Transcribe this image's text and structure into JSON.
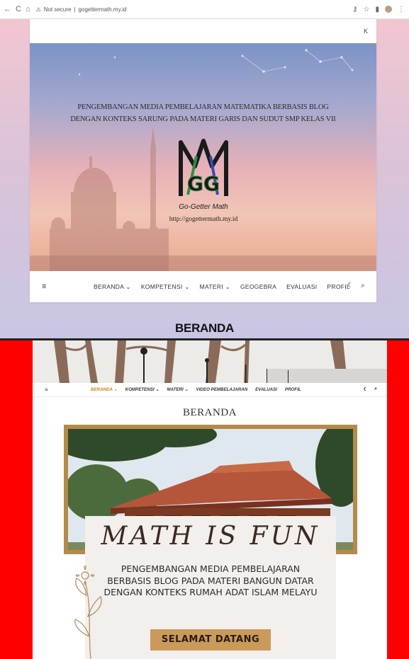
{
  "browser": {
    "security_label": "Not secure",
    "address": "gogettermath.my.id",
    "nav_back": "←",
    "nav_forward": "→",
    "nav_reload": "C",
    "nav_home": "⌂"
  },
  "site1": {
    "header_tool": "K",
    "hero_title_line1": "PENGEMBANGAN MEDIA PEMBELAJARAN MATEMATIKA BERBASIS BLOG",
    "hero_title_line2": "DENGAN KONTEKS SARUNG PADA MATERI GARIS DAN SUDUT SMP KELAS VII",
    "logo_text": "GG",
    "brand": "Go-Getter Math",
    "url": "http://gogettermath.my.id",
    "menu": [
      "BERANDA ⌄",
      "KOMPETENSI ⌄",
      "MATERI ⌄",
      "GEOGEBRA",
      "EVALUASI",
      "PROFIL"
    ]
  },
  "caption": "BERANDA",
  "site2": {
    "menu": [
      "BERANDA ⌄",
      "KOMPETENSI ⌄",
      "MATERI ⌄",
      "VIDEO PEMBELAJARAN",
      "EVALUASI",
      "PROFIL"
    ],
    "page_title": "BERANDA",
    "script_title": "MATH IS FUN",
    "description": "PENGEMBANGAN MEDIA PEMBELAJARAN BERBASIS BLOG PADA MATERI BANGUN DATAR DENGAN KONTEKS RUMAH ADAT ISLAM MELAYU",
    "button": "SELAMAT DATANG"
  },
  "colors": {
    "accent_orange": "#c9871c",
    "frame_gold": "#b48a4a",
    "button_gold": "#c99a5a",
    "side_red": "#ff0000"
  }
}
